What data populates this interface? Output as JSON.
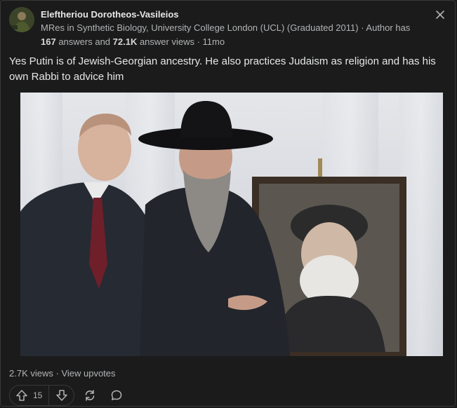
{
  "author": {
    "name": "Eleftheriou Dorotheos-Vasileios",
    "credential": "MRes in Synthetic Biology, University College London (UCL) (Graduated 2011)",
    "sep1": " · ",
    "answers_prefix": "Author has ",
    "answers_count": "167",
    "answers_suffix": " answers and ",
    "views_count": "72.1K",
    "views_suffix": " answer views",
    "sep2": " · ",
    "time_ago": "11mo"
  },
  "answer": {
    "text": "Yes Putin is of Jewish-Georgian ancestry. He also practices Judaism as religion and has his own Rabbi to advice him"
  },
  "stats": {
    "views": "2.7K views",
    "separator": " · ",
    "view_upvotes": "View upvotes"
  },
  "actions": {
    "upvote_count": "15"
  },
  "icons": {
    "close": "close-icon",
    "upvote": "upvote-arrow-icon",
    "downvote": "downvote-arrow-icon",
    "share": "share-icon",
    "comment": "comment-icon"
  },
  "colors": {
    "background": "#1b1b1b",
    "border": "#393839",
    "text_primary": "#e6e7e8",
    "text_secondary": "#b1b3b6"
  }
}
